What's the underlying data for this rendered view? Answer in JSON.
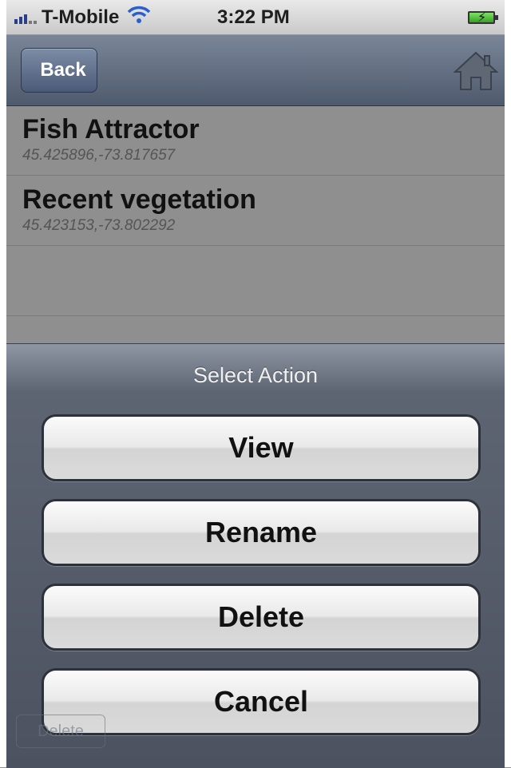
{
  "status_bar": {
    "carrier": "T-Mobile",
    "time": "3:22 PM",
    "icons": [
      "signal-icon",
      "wifi-icon",
      "battery-icon"
    ]
  },
  "nav": {
    "back_label": "Back",
    "home_icon": "home-icon"
  },
  "list": {
    "items": [
      {
        "title": "Fish Attractor",
        "coords": "45.425896,-73.817657"
      },
      {
        "title": "Recent vegetation",
        "coords": "45.423153,-73.802292"
      }
    ]
  },
  "action_sheet": {
    "title": "Select Action",
    "buttons": {
      "view": "View",
      "rename": "Rename",
      "delete": "Delete",
      "cancel": "Cancel"
    }
  },
  "background_delete": "Delete",
  "colors": {
    "nav_bar": "#5b6779",
    "sheet": "#4c5260",
    "button_text": "#111111"
  }
}
